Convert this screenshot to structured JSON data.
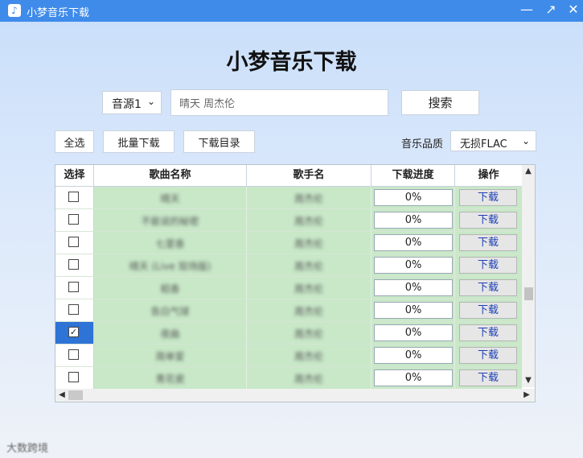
{
  "window": {
    "title": "小梦音乐下载",
    "icon": "music-note-icon",
    "controls": {
      "minimize": "—",
      "restore": "↗",
      "close": "✕"
    }
  },
  "header": {
    "title": "小梦音乐下载"
  },
  "search": {
    "source_value": "音源1",
    "query_value": "晴天 周杰伦",
    "button_label": "搜索"
  },
  "toolbar": {
    "select_all_label": "全选",
    "batch_download_label": "批量下载",
    "download_dir_label": "下载目录",
    "quality_label": "音乐品质",
    "quality_value": "无损FLAC"
  },
  "table": {
    "headers": [
      "选择",
      "歌曲名称",
      "歌手名",
      "下载进度",
      "操作"
    ],
    "rows": [
      {
        "checked": false,
        "song": "晴天",
        "artist": "周杰伦",
        "progress": "0%",
        "action": "下载"
      },
      {
        "checked": false,
        "song": "不能说的秘密",
        "artist": "周杰伦",
        "progress": "0%",
        "action": "下载"
      },
      {
        "checked": false,
        "song": "七里香",
        "artist": "周杰伦",
        "progress": "0%",
        "action": "下载"
      },
      {
        "checked": false,
        "song": "晴天 (Live 现场版)",
        "artist": "周杰伦",
        "progress": "0%",
        "action": "下载"
      },
      {
        "checked": false,
        "song": "稻香",
        "artist": "周杰伦",
        "progress": "0%",
        "action": "下载"
      },
      {
        "checked": false,
        "song": "告白气球",
        "artist": "周杰伦",
        "progress": "0%",
        "action": "下载"
      },
      {
        "checked": true,
        "song": "夜曲",
        "artist": "周杰伦",
        "progress": "0%",
        "action": "下载"
      },
      {
        "checked": false,
        "song": "简单爱",
        "artist": "周杰伦",
        "progress": "0%",
        "action": "下载"
      },
      {
        "checked": false,
        "song": "青花瓷",
        "artist": "周杰伦",
        "progress": "0%",
        "action": "下载"
      }
    ]
  },
  "footer": {
    "watermark": "大数跨境"
  }
}
